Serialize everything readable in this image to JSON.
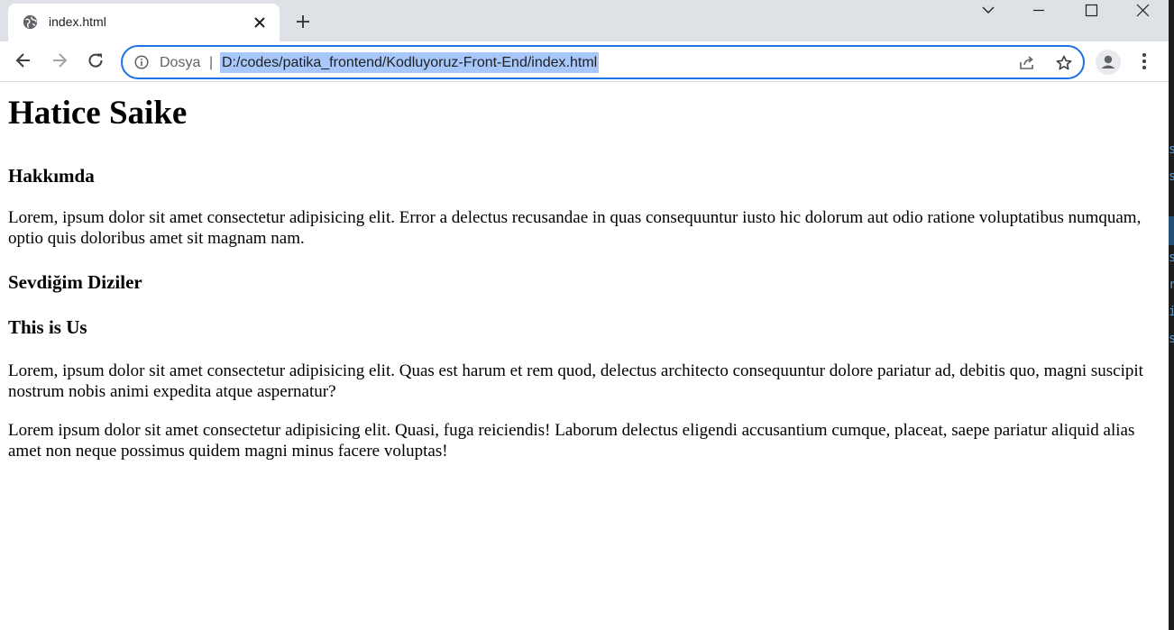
{
  "browser": {
    "tab": {
      "title": "index.html"
    },
    "omnibox": {
      "chip_label": "Dosya",
      "separator": "|",
      "url": "D:/codes/patika_frontend/Kodluyoruz-Front-End/index.html"
    }
  },
  "page": {
    "name": "Hatice Saike",
    "about_heading": "Hakkımda",
    "about_text": "Lorem, ipsum dolor sit amet consectetur adipisicing elit. Error a delectus recusandae in quas consequuntur iusto hic dolorum aut odio ratione voluptatibus numquam, optio quis doloribus amet sit magnam nam.",
    "favorites_heading": "Sevdiğim Diziler",
    "show_title": "This is Us",
    "show_paragraph_1": "Lorem, ipsum dolor sit amet consectetur adipisicing elit. Quas est harum et rem quod, delectus architecto consequuntur dolore pariatur ad, debitis quo, magni suscipit nostrum nobis animi expedita atque aspernatur?",
    "show_paragraph_2": "Lorem ipsum dolor sit amet consectetur adipisicing elit. Quasi, fuga reiciendis! Laborum delectus eligendi accusantium cumque, placeat, saepe pariatur aliquid alias amet non neque possimus quidem magni minus facere voluptas!"
  },
  "editor_sliver": {
    "glyphs": [
      "s",
      "s",
      "s",
      "r",
      "i",
      "s"
    ]
  },
  "colors": {
    "tab_strip": "#dee1e6",
    "focus_ring": "#1a73e8",
    "url_selection": "#a8c7fa",
    "editor_bg": "#1e1e1e"
  },
  "icons": {
    "tab_favicon": "globe-icon",
    "tab_close": "close-icon",
    "new_tab": "plus-icon",
    "back": "arrow-left-icon",
    "forward": "arrow-right-icon",
    "reload": "reload-icon",
    "site_info": "info-icon",
    "share": "share-icon",
    "bookmark": "star-icon",
    "profile": "person-icon",
    "menu": "kebab-menu-icon"
  }
}
